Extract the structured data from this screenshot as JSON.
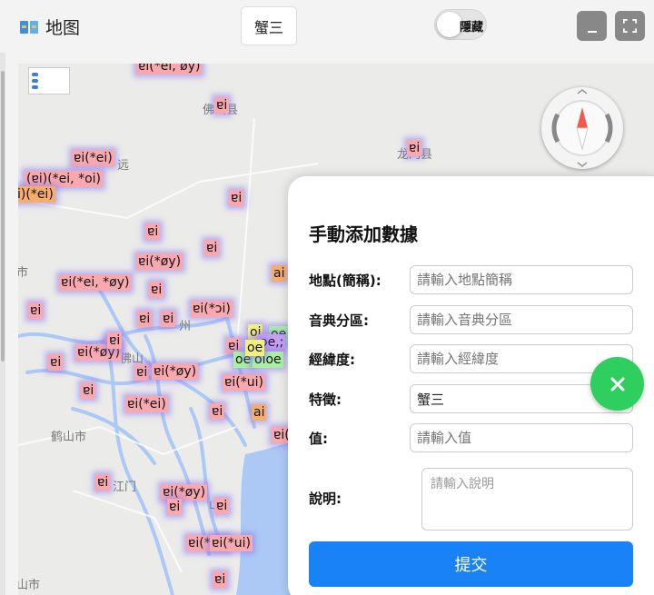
{
  "header": {
    "title": "地图",
    "feature_button": "蟹三",
    "toggle_label": "隱藏"
  },
  "map": {
    "places": [
      "佛山县",
      "龙门县",
      "远",
      "市",
      "州",
      "佛山",
      "鹤山市",
      "江门",
      "山市",
      "山",
      "鹤"
    ],
    "points": [
      "ɐi(*ei, øy)",
      "ɐi",
      "ɐi",
      "ɐi(*ei)",
      "(ɐi)(*ei, *oi)",
      "i)(*ei)",
      "ɐi",
      "ɐi",
      "ɐi",
      "ɐi(*øy)",
      "ɐi(*ei, *øy)",
      "ɐi",
      "ai",
      "ɐi",
      "ɐi",
      "ɐi(*ɔi)",
      "ɐi",
      "ɐi",
      "ɐi(*øy)",
      "ɐi",
      "ɐi",
      "ɐi",
      "ɐi",
      "ɐi(*øy)",
      "ɐi(*ui)",
      "ɐi(*ei)",
      "ai",
      "ɐi",
      "ɐi(",
      "ɐi",
      "ɐi(*øy)",
      "ɐi",
      "ɐi",
      "ɐi(*ui)",
      "ɐi(*ui)",
      "ɐi",
      "oi",
      "oe",
      "oe,;",
      "oe",
      "oioe",
      "oe",
      "ɐi"
    ],
    "status_colors": {
      "default": "#f8a8ae",
      "orange": "#f7ad6a",
      "yellow": "#f3f07a",
      "green": "#a7f1a0",
      "purple": "#c9a0f6"
    }
  },
  "form": {
    "title": "手動添加數據",
    "fields": [
      {
        "label": "地點(簡稱):",
        "placeholder": "請輸入地點簡稱",
        "value": ""
      },
      {
        "label": "音典分區:",
        "placeholder": "請輸入音典分區",
        "value": ""
      },
      {
        "label": "經緯度:",
        "placeholder": "請輸入經緯度",
        "value": ""
      },
      {
        "label": "特徵:",
        "placeholder": "",
        "value": "蟹三"
      },
      {
        "label": "值:",
        "placeholder": "請輸入值",
        "value": ""
      }
    ],
    "notes": {
      "label": "說明:",
      "placeholder": "請輸入說明"
    },
    "submit_label": "提交",
    "close_icon": "close-icon"
  },
  "colors": {
    "accent": "#1a82f7",
    "close_button": "#2ecf5e",
    "window_button": "#888888"
  }
}
